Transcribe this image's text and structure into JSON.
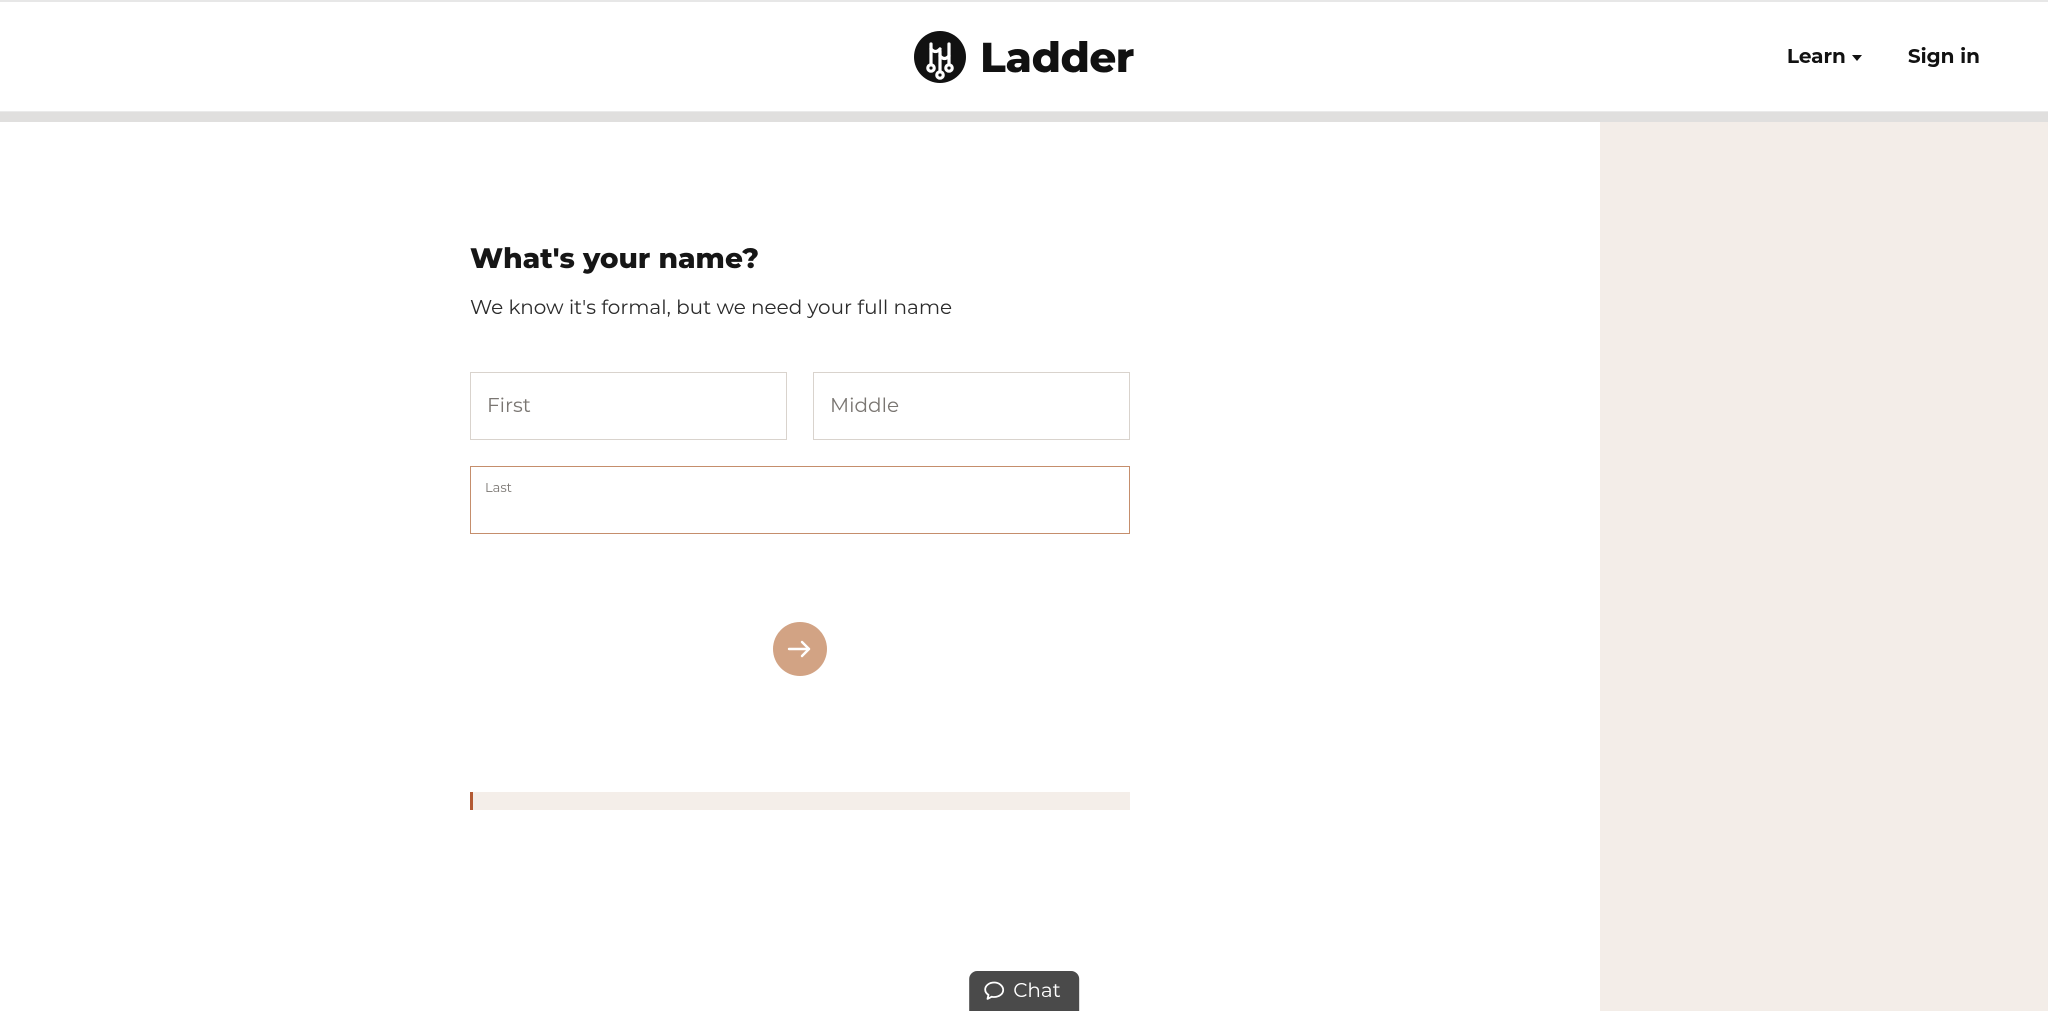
{
  "brand": {
    "name": "Ladder"
  },
  "nav": {
    "learn": "Learn",
    "signin": "Sign in"
  },
  "form": {
    "heading": "What's your name?",
    "subtext": "We know it's formal, but we need your full name",
    "first_placeholder": "First",
    "middle_placeholder": "Middle",
    "last_label": "Last",
    "first_value": "",
    "middle_value": "",
    "last_value": ""
  },
  "chat": {
    "label": "Chat"
  },
  "colors": {
    "accent": "#d2a384",
    "focus_border": "#c58e6c",
    "sidebar_bg": "#f3ede8",
    "card_border": "#b35a34"
  }
}
